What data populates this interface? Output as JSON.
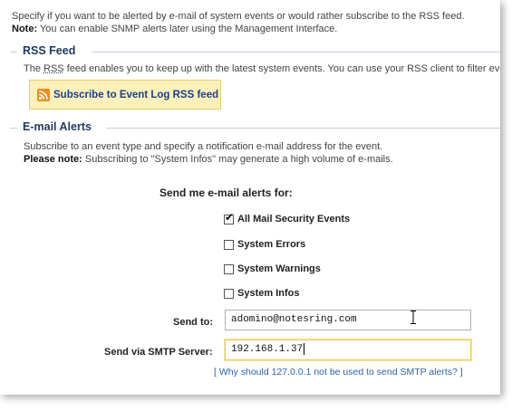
{
  "intro": {
    "line1": "Specify if you want to be alerted by e-mail of system events or would rather subscribe to the RSS feed.",
    "note_label": "Note:",
    "note_text": " You can enable SNMP alerts later using the Management Interface."
  },
  "rss": {
    "title": "RSS Feed",
    "desc_pre": "The ",
    "desc_abbr": "RSS",
    "desc_post": " feed enables you to keep up with the latest system events. You can use your RSS client to filter eve",
    "button_label": "Subscribe to Event Log RSS feed",
    "icon": "rss-feed-icon"
  },
  "email": {
    "title": "E-mail Alerts",
    "desc": "Subscribe to an event type and specify a notification e-mail address for the event.",
    "note_label": "Please note:",
    "note_text": " Subscribing to \"System Infos\" may generate a high volume of e-mails."
  },
  "form": {
    "heading": "Send me e-mail alerts for:",
    "options": [
      {
        "label": "All Mail Security Events",
        "checked": true
      },
      {
        "label": "System Errors",
        "checked": false
      },
      {
        "label": "System Warnings",
        "checked": false
      },
      {
        "label": "System Infos",
        "checked": false
      }
    ],
    "send_to_label": "Send to:",
    "send_to_value": "adomino@notesring.com",
    "smtp_label": "Send via SMTP Server:",
    "smtp_value": "192.168.1.37",
    "help_link": "[ Why should 127.0.0.1 not be used to send SMTP alerts? ]"
  },
  "colors": {
    "section_title": "#1f3a63",
    "link": "#2f62ad",
    "rss_button_bg": "#fbf0b8",
    "rss_icon": "#f08c1a"
  }
}
